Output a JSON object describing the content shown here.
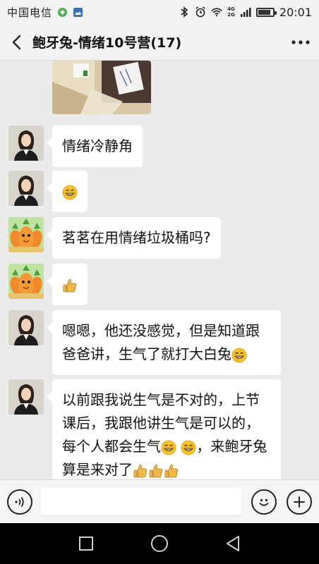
{
  "status_bar": {
    "carrier": "中国电信",
    "net_badge_top": "4G",
    "net_badge_bottom": "2G",
    "time": "20:01",
    "battery_level": 0.85
  },
  "header": {
    "title": "鲍牙兔-情绪10号营(17)",
    "back_icon": "chevron-left-icon",
    "more_icon": "ellipsis-icon"
  },
  "messages": [
    {
      "type": "image",
      "sender": "avatar-woman"
    },
    {
      "type": "text",
      "sender": "avatar-woman",
      "text": "情绪冷静角"
    },
    {
      "type": "emoji",
      "sender": "avatar-woman",
      "emoji": "grin-emoji"
    },
    {
      "type": "text",
      "sender": "avatar-carrot",
      "text": "茗茗在用情绪垃圾桶吗?"
    },
    {
      "type": "emoji",
      "sender": "avatar-carrot",
      "emoji": "thumbs-up-emoji"
    },
    {
      "type": "text",
      "sender": "avatar-woman",
      "line1": "嗯嗯，他还没感觉，但是知道跟",
      "line2": "爸爸讲，生气了就打大白兔"
    },
    {
      "type": "text",
      "sender": "avatar-woman",
      "line1": "以前跟我说生气是不对的，上节",
      "line2": "课后，我跟他讲生气是可以的，",
      "line3": "每个人都会生气",
      "line3b": "，来鲍牙兔",
      "line4": "算是来对了"
    }
  ],
  "input_bar": {
    "voice_icon": "voice-icon",
    "emoji_icon": "smiley-icon",
    "plus_icon": "plus-icon",
    "placeholder": ""
  },
  "nav_bar": {
    "icons": [
      "square-icon",
      "circle-icon",
      "triangle-back-icon"
    ]
  },
  "colors": {
    "bubble": "#ffffff",
    "background": "#ebebeb",
    "emoji_yellow": "#f6c22c",
    "thumb_yellow": "#f0b84a"
  }
}
